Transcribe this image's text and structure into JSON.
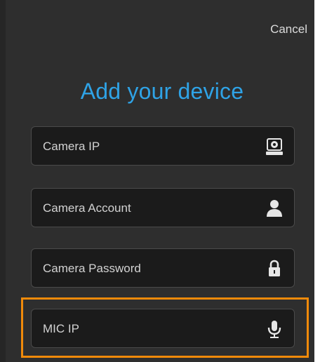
{
  "header": {
    "cancel_label": "Cancel"
  },
  "title": "Add your device",
  "fields": [
    {
      "placeholder": "Camera IP",
      "icon": "camera-icon"
    },
    {
      "placeholder": "Camera Account",
      "icon": "user-icon"
    },
    {
      "placeholder": "Camera Password",
      "icon": "lock-icon"
    },
    {
      "placeholder": "MIC IP",
      "icon": "microphone-icon"
    }
  ],
  "colors": {
    "accent": "#2fa3e6",
    "highlight": "#f08a0a",
    "panel": "#2e2e2e",
    "field_bg": "#1b1b1b"
  }
}
